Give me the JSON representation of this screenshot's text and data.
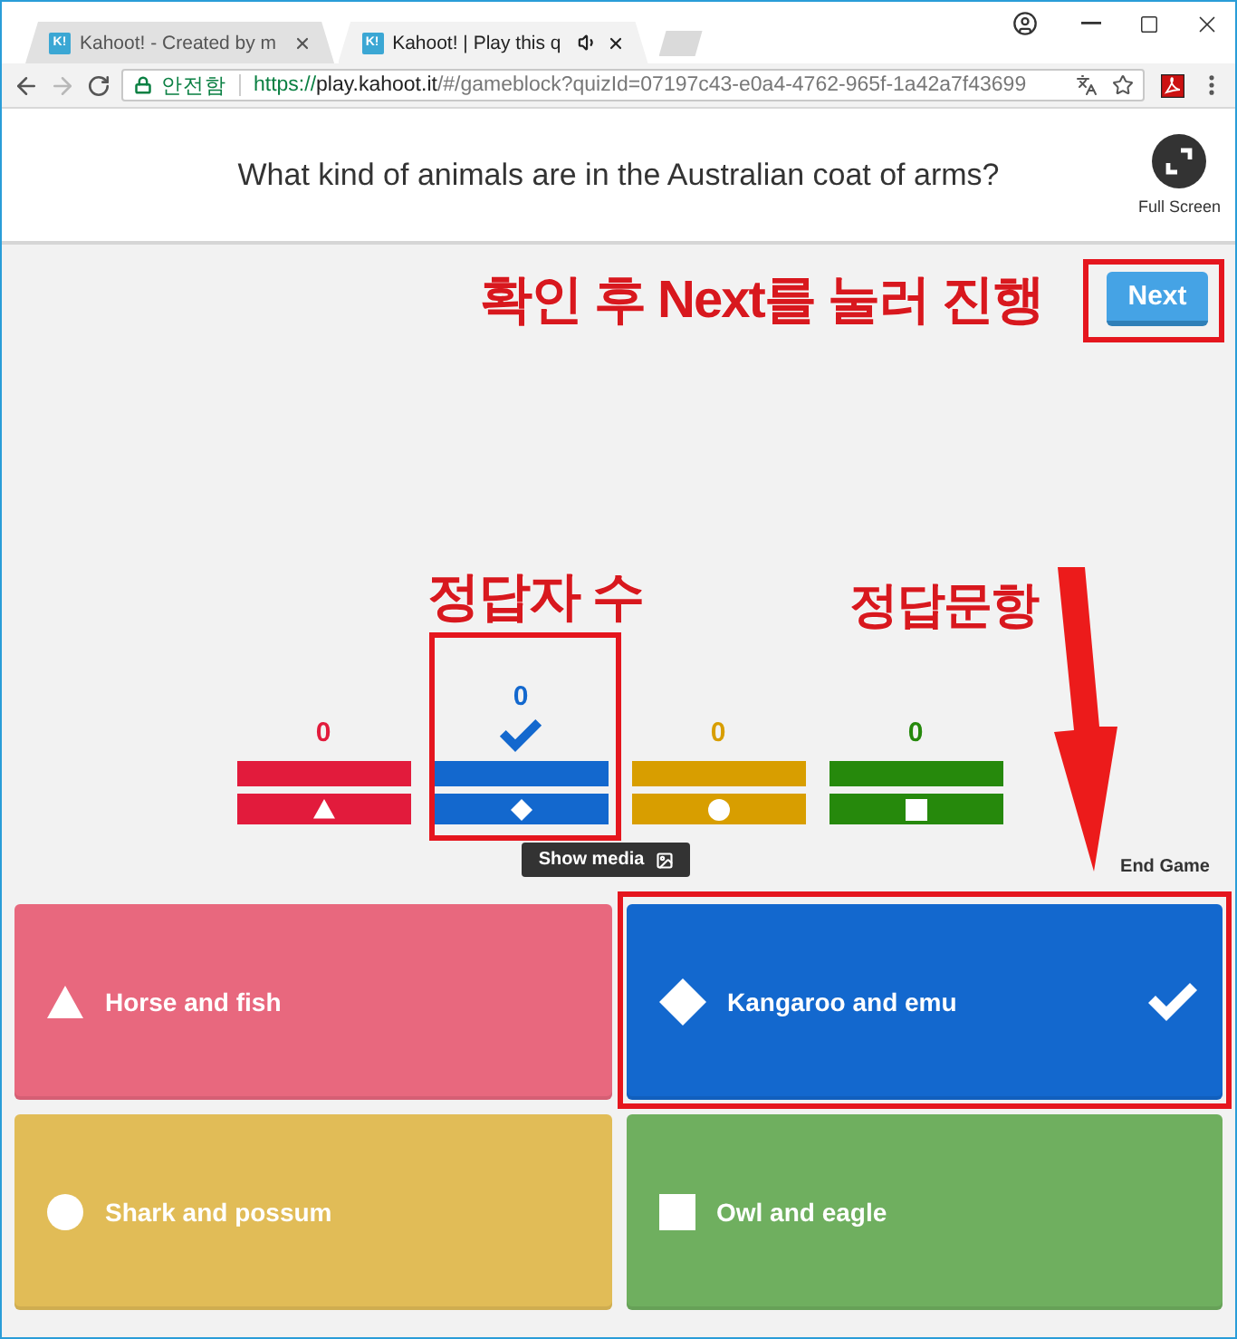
{
  "browser": {
    "tabs": [
      {
        "icon_text": "K!",
        "title": "Kahoot! - Created by m",
        "selected": false,
        "audio": false
      },
      {
        "icon_text": "K!",
        "title": "Kahoot! | Play this q",
        "selected": true,
        "audio": true
      }
    ],
    "nav": {
      "forward_disabled": true
    },
    "address_bar": {
      "secure_label": "안전함",
      "url": {
        "scheme": "https://",
        "host": "play.kahoot.it",
        "path": "/#/gameblock?quizId=07197c43-e0a4-4762-965f-1a42a7f43699"
      }
    }
  },
  "question": {
    "text": "What kind of animals are in the Australian coat of arms?",
    "fullscreen_label": "Full Screen"
  },
  "next_button": {
    "label": "Next",
    "highlighted": true
  },
  "results": [
    {
      "count": "0",
      "kind": "triangle",
      "color": "#e21b3c",
      "correct": false,
      "highlighted": false
    },
    {
      "count": "0",
      "kind": "diamond",
      "color": "#1368ce",
      "correct": true,
      "highlighted": true
    },
    {
      "count": "0",
      "kind": "circle",
      "color": "#d89e00",
      "correct": false,
      "highlighted": false
    },
    {
      "count": "0",
      "kind": "square",
      "color": "#26890c",
      "correct": false,
      "highlighted": false
    }
  ],
  "show_media_button": "Show media",
  "end_game_link": "End Game",
  "answers": [
    {
      "text": "Horse and fish",
      "kind": "triangle",
      "correct": false,
      "highlighted": false
    },
    {
      "text": "Kangaroo and emu",
      "kind": "diamond",
      "correct": true,
      "highlighted": true
    },
    {
      "text": "Shark and possum",
      "kind": "circle",
      "correct": false,
      "highlighted": false
    },
    {
      "text": "Owl and eagle",
      "kind": "square",
      "correct": false,
      "highlighted": false
    }
  ],
  "annotations": {
    "next_hint": "확인 후 Next를 눌러 진행",
    "count_label": "정답자 수",
    "answer_label": "정답문항"
  }
}
